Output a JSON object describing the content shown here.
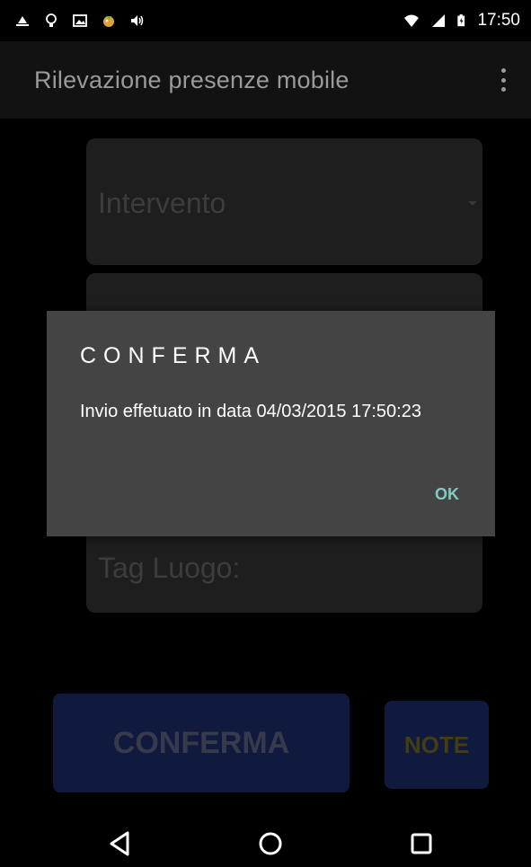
{
  "status_bar": {
    "time": "17:50",
    "left_icons": [
      "upload-icon",
      "lightbulb-icon",
      "image-icon",
      "game-icon",
      "volume-icon"
    ],
    "right_icons": [
      "wifi-icon",
      "signal-icon",
      "battery-icon"
    ]
  },
  "app_bar": {
    "title": "Rilevazione presenze mobile",
    "overflow_icon": "more-vertical-icon"
  },
  "form": {
    "intervento_label": "Intervento",
    "tag_luogo_label": "Tag Luogo:"
  },
  "dialog": {
    "title": "CONFERMA",
    "message": "Invio effetuato in data 04/03/2015 17:50:23",
    "ok_label": "OK"
  },
  "buttons": {
    "conferma_label": "CONFERMA",
    "note_label": "NOTE"
  },
  "nav_bar": {
    "icons": [
      "back-icon",
      "home-icon",
      "recents-icon"
    ]
  },
  "colors": {
    "accent": "#80cbc4",
    "button_bg": "#1a2860",
    "dialog_bg": "#444444"
  }
}
